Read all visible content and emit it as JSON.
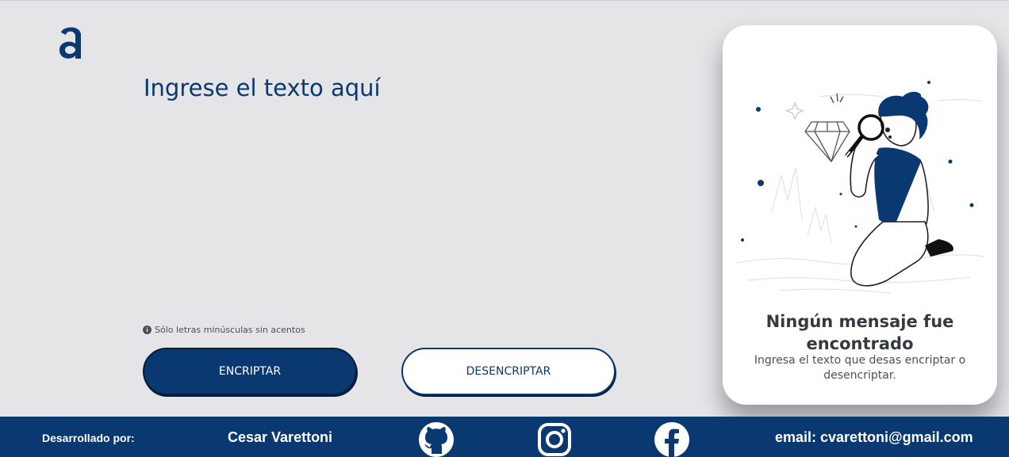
{
  "brand": {
    "logo_glyph": "a",
    "logo_icon": "alura-logo-icon"
  },
  "input": {
    "placeholder": "Ingrese el texto aquí",
    "value": ""
  },
  "hint": {
    "icon": "info-icon",
    "text": "Sólo letras minúsculas sin acentos"
  },
  "buttons": {
    "encrypt_label": "ENCRIPTAR",
    "decrypt_label": "DESENCRIPTAR"
  },
  "output": {
    "illustration": "person-with-magnifier-illustration",
    "title": "Ningún mensaje fue encontrado",
    "subtitle": "Ingresa el texto que desas encriptar o desencriptar."
  },
  "footer": {
    "developed_by": "Desarrollado por:",
    "author": "Cesar Varettoni",
    "icons": [
      "github-icon",
      "instagram-icon",
      "facebook-icon"
    ],
    "email": "email: cvarettoni@gmail.com"
  },
  "colors": {
    "primary": "#0a3871",
    "background": "#e5e5e8",
    "panel": "#ffffff"
  }
}
